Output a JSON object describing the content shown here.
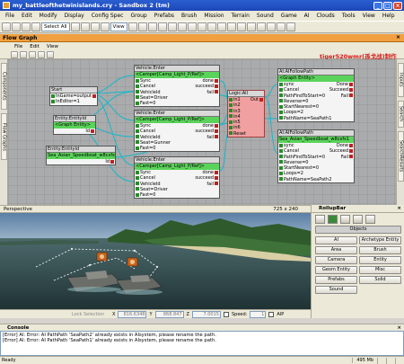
{
  "window": {
    "title": "my_battleofthetwinislands.cry - Sandbox 2 (tm)"
  },
  "menu": [
    "File",
    "Edit",
    "Modify",
    "Display",
    "Config Spec",
    "Group",
    "Prefabs",
    "Brush",
    "Mission",
    "Terrain",
    "Sound",
    "Game",
    "AI",
    "Clouds",
    "Tools",
    "View",
    "Help"
  ],
  "toolbar": {
    "select_value": "Select All",
    "view_value": "View"
  },
  "flowgraph": {
    "title": "Flow Graph",
    "menu": [
      "File",
      "Edit",
      "View"
    ],
    "credit": "tiger520wmr(孫戈战)制作",
    "left_tabs": [
      "Components",
      "Flow Graphs"
    ],
    "right_tabs": [
      "Inputs",
      "Search",
      "SearchResults"
    ]
  },
  "nodes": {
    "start": {
      "title": "Start",
      "rows": [
        [
          "InGame=1",
          "output"
        ],
        [
          "InEditor=1",
          ""
        ]
      ]
    },
    "entity1": {
      "title": "Entity:EntityId",
      "green": "<Graph Entity>",
      "rows": [
        [
          "",
          "Id"
        ]
      ]
    },
    "entity2": {
      "title": "Entity:EntityId",
      "green": "Sea_Asian_Speedboat_w8cxfs1",
      "rows": [
        [
          "",
          "Id"
        ]
      ]
    },
    "vehicle1": {
      "title": "Vehicle:Enter",
      "green": "<Camper[Camp_Light_P/Ref]>",
      "rows": [
        [
          "Sync",
          "done"
        ],
        [
          "Cancel",
          "succeed"
        ],
        [
          "VehicleId",
          "fail"
        ],
        [
          "Seat=Driver",
          ""
        ],
        [
          "Fast=0",
          ""
        ]
      ]
    },
    "vehicle2": {
      "title": "Vehicle:Enter",
      "green": "<Camper[Camp_Light_P/Ref]>",
      "rows": [
        [
          "Sync",
          "done"
        ],
        [
          "Cancel",
          "succeed"
        ],
        [
          "VehicleId",
          "fail"
        ],
        [
          "Seat=Gunner",
          ""
        ],
        [
          "Fast=0",
          ""
        ]
      ]
    },
    "vehicle3": {
      "title": "Vehicle:Enter",
      "green": "<Camper[Camp_Light_P/Ref]>",
      "rows": [
        [
          "Sync",
          "done"
        ],
        [
          "Cancel",
          "succeed"
        ],
        [
          "VehicleId",
          "fail"
        ],
        [
          "Seat=Driver",
          ""
        ],
        [
          "Fast=0",
          ""
        ]
      ]
    },
    "logic": {
      "title": "Logic:All",
      "rows": [
        [
          "in1",
          "Out"
        ],
        [
          "in2",
          ""
        ],
        [
          "in3",
          ""
        ],
        [
          "in4",
          ""
        ],
        [
          "in5",
          ""
        ],
        [
          "in6",
          ""
        ],
        [
          "Reset",
          ""
        ]
      ]
    },
    "ai1": {
      "title": "AI:AIFollowPath",
      "green": "<Graph Entity>",
      "rows": [
        [
          "sync",
          "Done"
        ],
        [
          "Cancel",
          "Succeed"
        ],
        [
          "PathFindToStart=0",
          "Fail"
        ],
        [
          "Reverse=0",
          ""
        ],
        [
          "StartNearest=0",
          ""
        ],
        [
          "Loops=2",
          ""
        ],
        [
          "PathName=SeaPath1",
          ""
        ]
      ]
    },
    "ai2": {
      "title": "AI:AIFollowPath",
      "green": "Sea_Asian_Speedboat_w8cxfs1",
      "rows": [
        [
          "sync",
          "Done"
        ],
        [
          "Cancel",
          "Succeed"
        ],
        [
          "PathFindToStart=0",
          "Fail"
        ],
        [
          "Reverse=0",
          ""
        ],
        [
          "StartNearest=0",
          ""
        ],
        [
          "Loops=2",
          ""
        ],
        [
          "PathName=SeaPath2",
          ""
        ]
      ]
    }
  },
  "viewport": {
    "label": "Perspective",
    "size": "725 x 240"
  },
  "status_strip": {
    "lock": "Lock Selection",
    "x_label": "X",
    "x": "816.6348",
    "y_label": "Y",
    "y": "868.847",
    "z_label": "Z",
    "z": "7.0015",
    "speed_label": "Speed:",
    "speed": "1",
    "aip": "AIP"
  },
  "rollup": {
    "title": "RollupBar",
    "objects_label": "Objects",
    "buttons": [
      "AI",
      "Archetype Entity",
      "Area",
      "Brush",
      "Camera",
      "Entity",
      "Geom Entity",
      "Misc",
      "Prefabs",
      "Solid",
      "Sound"
    ]
  },
  "console": {
    "title": "Console",
    "lines": [
      "[Error] AI: Error: AI PathPath 'SeaPath2' already exists in AIsystem, please rename the path.",
      "[Error] AI: Error: AI PathPath 'SeaPath1' already exists in AIsystem, please rename the path."
    ]
  },
  "statusbar": {
    "ready": "Ready",
    "memory": "495 Mb"
  },
  "colors": {
    "title_blue": "#1c46b8",
    "flowgraph_orange": "#f0a040",
    "node_green": "#5ad35a",
    "logic_pink": "#f0a0a0",
    "credit_red": "#d41a1a"
  }
}
